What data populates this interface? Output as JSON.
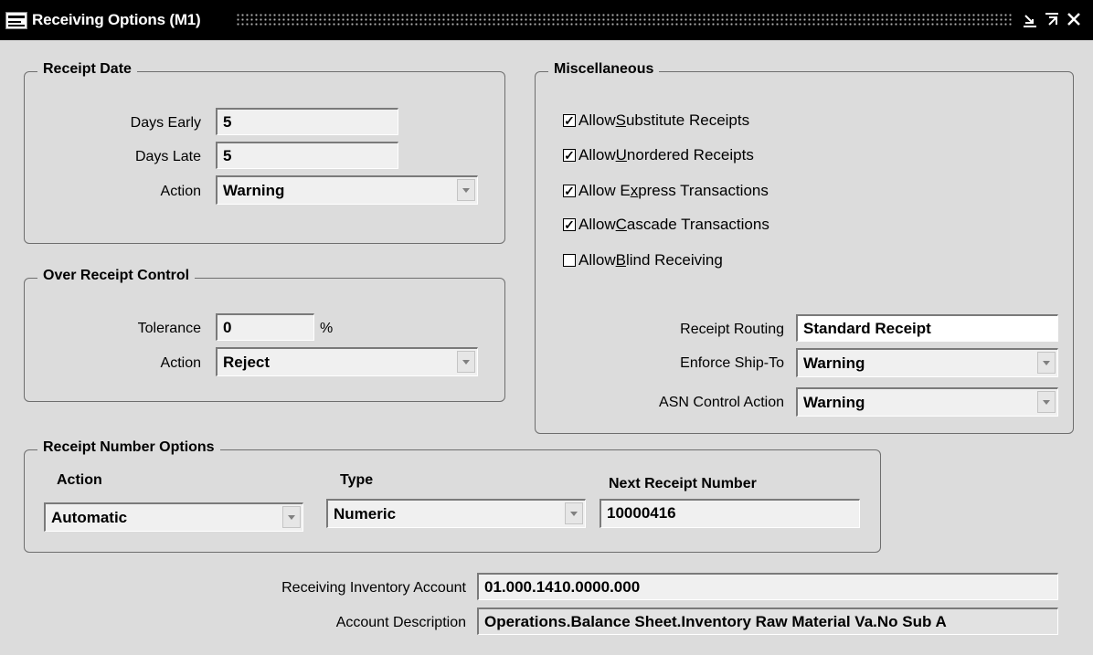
{
  "window": {
    "title": "Receiving Options (M1)",
    "controls": [
      "minimize-icon",
      "maximize-icon",
      "close-icon"
    ]
  },
  "receipt_date": {
    "group_title": "Receipt Date",
    "days_early_label": "Days Early",
    "days_early_value": "5",
    "days_late_label": "Days Late",
    "days_late_value": "5",
    "action_label": "Action",
    "action_value": "Warning"
  },
  "over_receipt": {
    "group_title": "Over Receipt Control",
    "tolerance_label": "Tolerance",
    "tolerance_value": "0",
    "percent_sign": "%",
    "action_label": "Action",
    "action_value": "Reject"
  },
  "misc": {
    "group_title": "Miscellaneous",
    "checkboxes": [
      {
        "pre": "Allow ",
        "key": "S",
        "post": "ubstitute Receipts",
        "checked": true
      },
      {
        "pre": "Allow ",
        "key": "U",
        "post": "nordered Receipts",
        "checked": true
      },
      {
        "pre": "Allow E",
        "key": "x",
        "post": "press Transactions",
        "checked": true
      },
      {
        "pre": "Allow ",
        "key": "C",
        "post": "ascade Transactions",
        "checked": true
      },
      {
        "pre": "Allow ",
        "key": "B",
        "post": "lind Receiving",
        "checked": false
      }
    ],
    "receipt_routing_label": "Receipt Routing",
    "receipt_routing_value": "Standard Receipt",
    "enforce_ship_to_label": "Enforce Ship-To",
    "enforce_ship_to_value": "Warning",
    "asn_control_label": "ASN Control Action",
    "asn_control_value": "Warning"
  },
  "receipt_number": {
    "group_title": "Receipt Number Options",
    "action_header": "Action",
    "action_value": "Automatic",
    "type_header": "Type",
    "type_value": "Numeric",
    "next_header": "Next Receipt Number",
    "next_value": "10000416"
  },
  "account": {
    "inventory_label": "Receiving Inventory Account",
    "inventory_value": "01.000.1410.0000.000",
    "description_label": "Account Description",
    "description_value": "Operations.Balance Sheet.Inventory Raw Material Va.No Sub A"
  }
}
